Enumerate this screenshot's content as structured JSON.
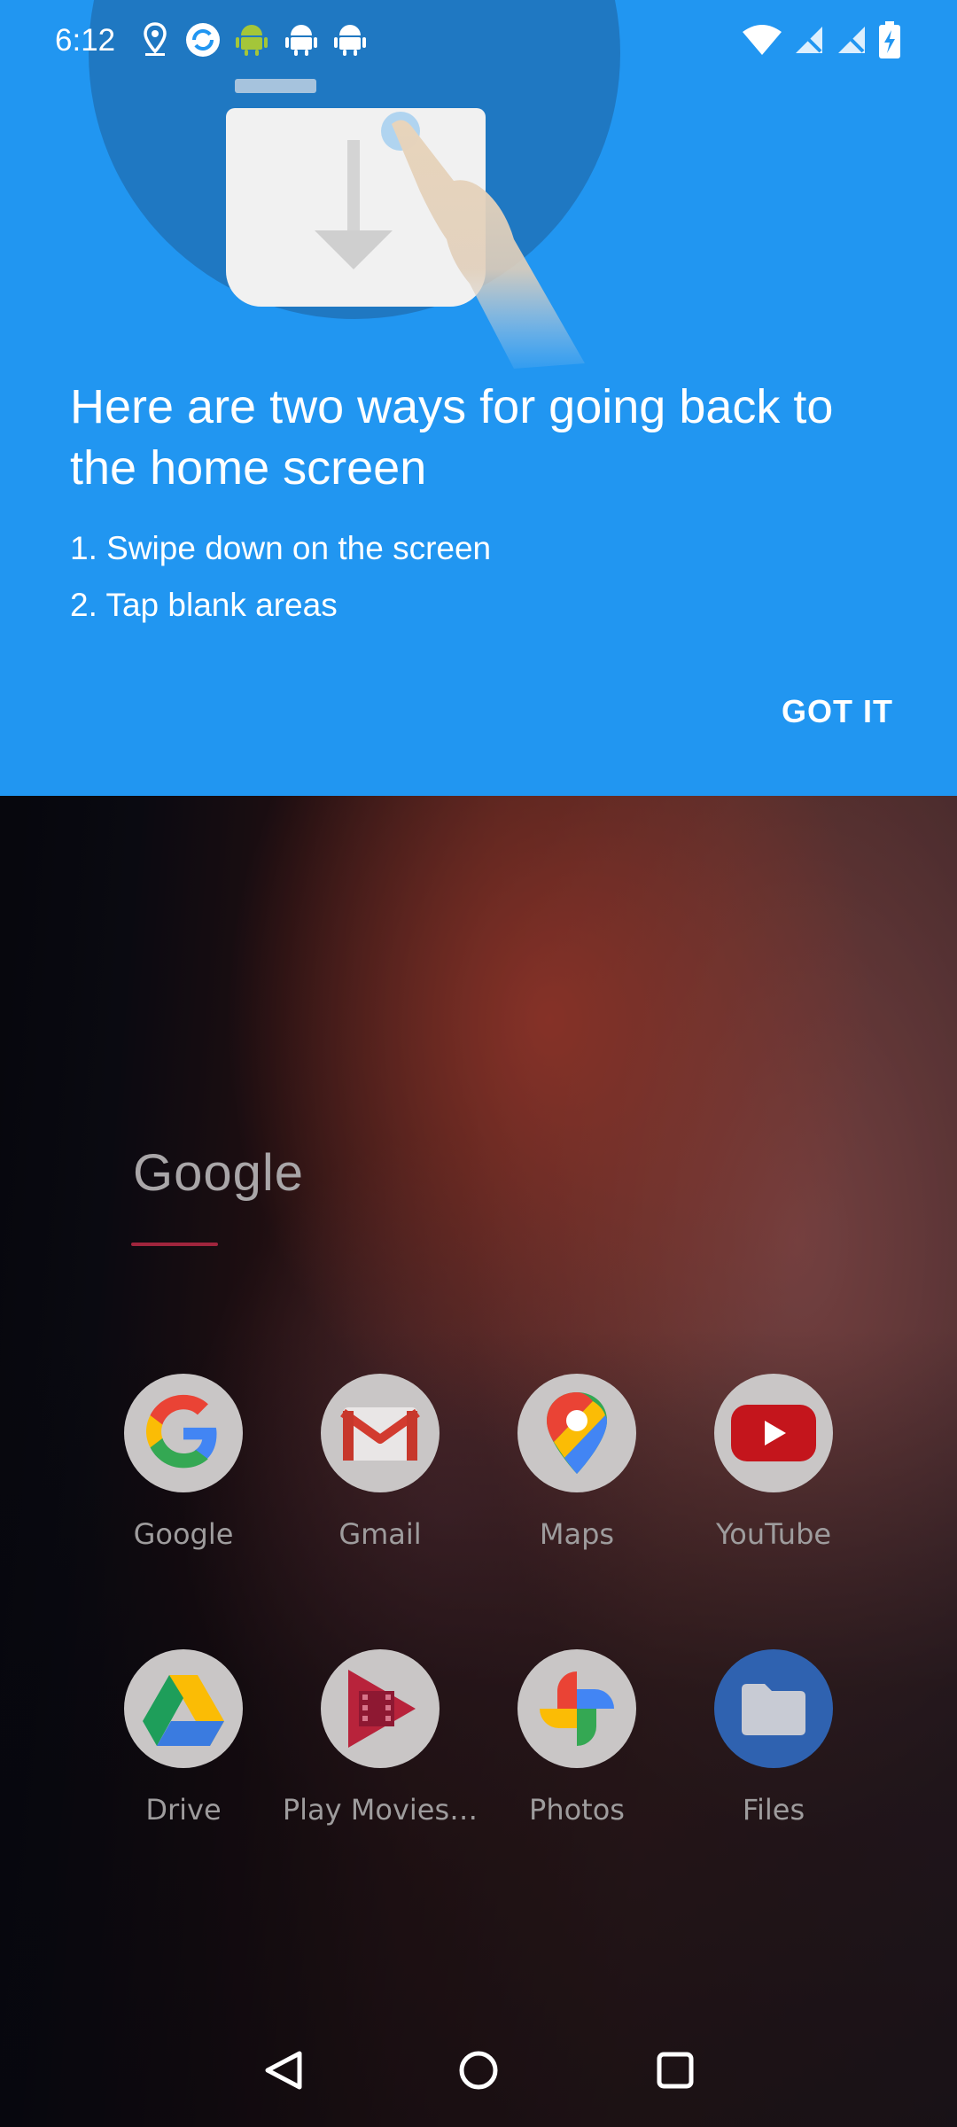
{
  "status_bar": {
    "time": "6:12",
    "left_icons": [
      "location-icon",
      "sync-icon",
      "android-icon",
      "android-icon",
      "android-icon"
    ],
    "right_icons": [
      "wifi-icon",
      "no-signal-icon",
      "no-signal-icon",
      "battery-charging-icon"
    ]
  },
  "tutorial": {
    "title": "Here are two ways for going back to the home screen",
    "steps": [
      "1. Swipe down on the screen",
      "2. Tap blank areas"
    ],
    "got_it_label": "GOT IT",
    "background_color": "#2196f1"
  },
  "home": {
    "search_widget_label": "Google",
    "apps": [
      {
        "label": "Google",
        "icon": "google-icon"
      },
      {
        "label": "Gmail",
        "icon": "gmail-icon"
      },
      {
        "label": "Maps",
        "icon": "maps-icon"
      },
      {
        "label": "YouTube",
        "icon": "youtube-icon"
      },
      {
        "label": "Drive",
        "icon": "drive-icon"
      },
      {
        "label": "Play Movies…",
        "icon": "play-movies-icon"
      },
      {
        "label": "Photos",
        "icon": "photos-icon"
      },
      {
        "label": "Files",
        "icon": "files-icon"
      }
    ]
  },
  "nav_bar": {
    "buttons": [
      "back-icon",
      "home-icon",
      "recents-icon"
    ]
  }
}
